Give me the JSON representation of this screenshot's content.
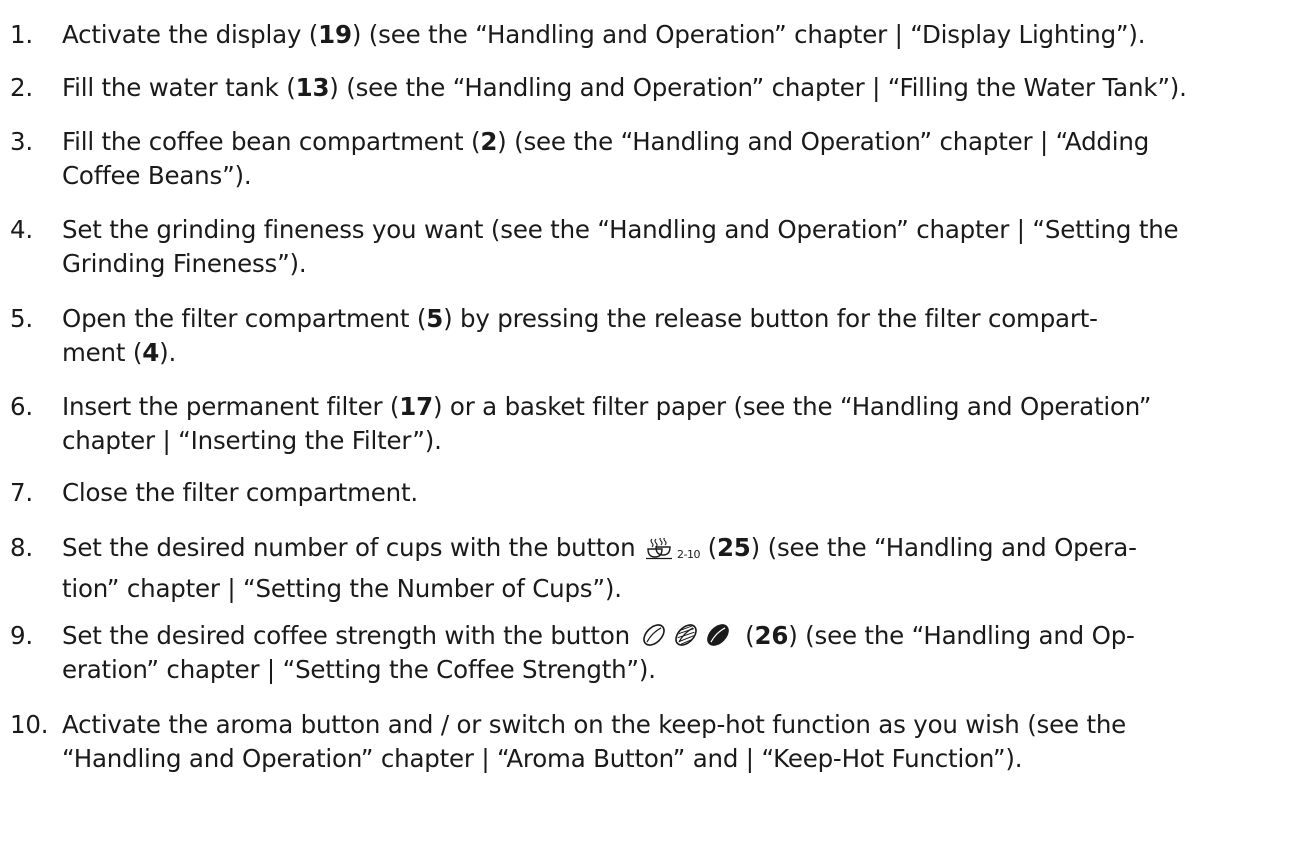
{
  "steps": [
    {
      "number": "1.",
      "lines": [
        [
          "Activate the display (",
          {
            "b": "19"
          },
          ") (see the “Handling and Operation” chapter | “Display Lighting”)."
        ]
      ]
    },
    {
      "number": "2.",
      "lines": [
        [
          "Fill the water tank (",
          {
            "b": "13"
          },
          ") (see the “Handling and Operation” chapter | “Filling the Water Tank”)."
        ]
      ]
    },
    {
      "number": "3.",
      "lines": [
        [
          "Fill the coffee bean compartment (",
          {
            "b": "2"
          },
          ") (see the “Handling and Operation” chapter | “Adding"
        ],
        [
          "Coffee Beans”)."
        ]
      ]
    },
    {
      "number": "4.",
      "lines": [
        [
          "Set the grinding fineness you want (see the “Handling and Operation” chapter | “Setting the"
        ],
        [
          "Grinding Fineness”)."
        ]
      ]
    },
    {
      "number": "5.",
      "lines": [
        [
          "Open the filter compartment (",
          {
            "b": "5"
          },
          ") by pressing the release button for the filter compart-"
        ],
        [
          "ment (",
          {
            "b": "4"
          },
          ")."
        ]
      ]
    },
    {
      "number": "6.",
      "lines": [
        [
          "Insert the permanent filter (",
          {
            "b": "17"
          },
          ") or a basket filter paper (see the “Handling and Operation”"
        ],
        [
          "chapter | “Inserting the Filter”)."
        ]
      ]
    },
    {
      "number": "7.",
      "lines": [
        [
          "Close the filter compartment."
        ]
      ]
    },
    {
      "number": "8.",
      "lines": [
        [
          "Set the desired number of cups with the button ",
          {
            "icon": "cups-icon",
            "sub": "2-10"
          },
          " (",
          {
            "b": "25"
          },
          ") (see the “Handling and Opera-"
        ],
        [
          "tion” chapter | “Setting the Number of Cups”)."
        ]
      ]
    },
    {
      "number": "9.",
      "lines": [
        [
          "Set the desired coffee strength with the button ",
          {
            "icon": "strength-icon"
          },
          " (",
          {
            "b": "26"
          },
          ") (see the “Handling and Op-"
        ],
        [
          "eration” chapter | “Setting the Coffee Strength”)."
        ]
      ]
    },
    {
      "number": "10.",
      "lines": [
        [
          "Activate the aroma button and / or switch on the keep-hot function as you wish (see the"
        ],
        [
          "“Handling and Operation” chapter | “Aroma Button” and | “Keep-Hot Function”)."
        ]
      ]
    }
  ]
}
